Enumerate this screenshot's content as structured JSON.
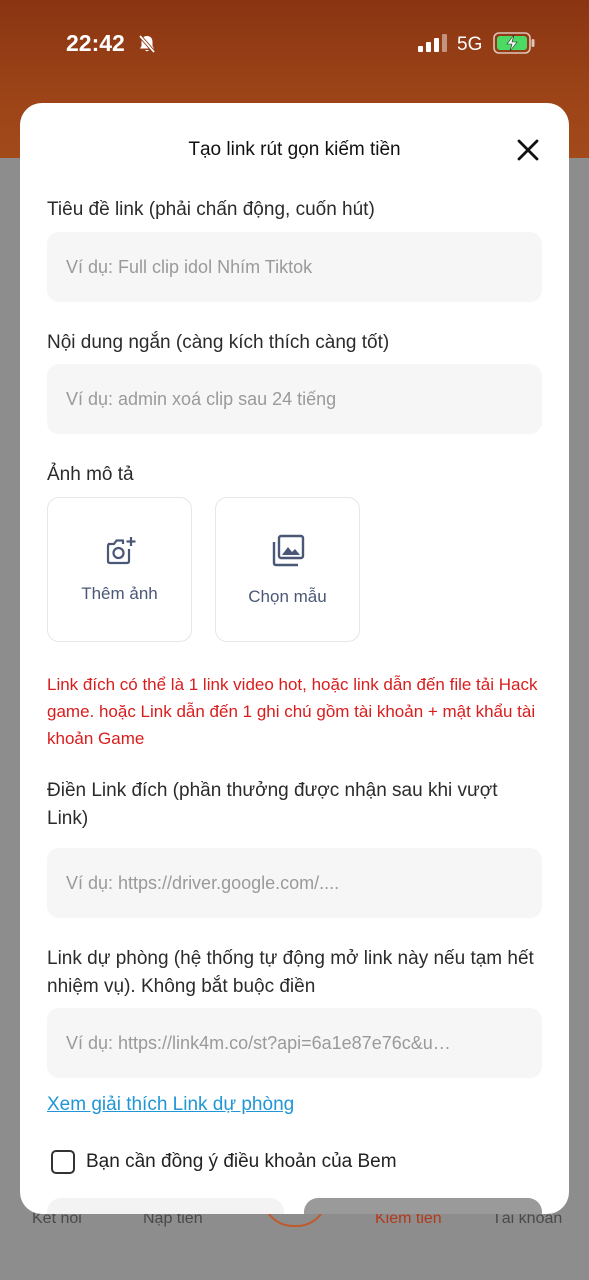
{
  "status_bar": {
    "time": "22:42",
    "network": "5G",
    "icons": [
      "bell-muted-icon",
      "signal-icon",
      "battery-charging-icon"
    ]
  },
  "bottom_nav": {
    "items": [
      "Kết nối",
      "Nạp tiền",
      "Kiếm tiền",
      "Tài khoản"
    ],
    "active": "Kiếm tiền"
  },
  "modal": {
    "title": "Tạo link rút gọn kiếm tiền",
    "title_field": {
      "label": "Tiêu đề link (phải chấn động, cuốn hút)",
      "placeholder": "Ví dụ: Full clip idol Nhím Tiktok"
    },
    "content_field": {
      "label": "Nội dung ngắn (càng kích thích càng tốt)",
      "placeholder": "Ví dụ: admin xoá clip sau 24 tiếng"
    },
    "image_section": {
      "label": "Ảnh mô tả",
      "add_photo": "Thêm ảnh",
      "choose_template": "Chọn mẫu"
    },
    "warning": "Link đích có thể là 1 link video hot, hoặc link dẫn đến file tải Hack game. hoặc Link dẫn đến 1 ghi chú gồm tài khoản + mật khẩu tài khoản Game",
    "target_field": {
      "label": "Điền Link đích (phần thưởng được nhận sau khi vượt Link)",
      "placeholder": "Ví dụ: https://driver.google.com/...."
    },
    "backup_field": {
      "label": "Link dự phòng (hệ thống tự động mở link này nếu tạm hết nhiệm vụ). Không bắt buộc điền",
      "placeholder": "Ví dụ: https://link4m.co/st?api=6a1e87e76c&u…"
    },
    "help_link": "Xem giải thích Link dự phòng",
    "agree_label": "Bạn cần đồng ý điều khoản của Bem",
    "agree_checked": false
  },
  "colors": {
    "accent_red": "#d91d1d",
    "link_blue": "#2196d6",
    "header_brown": "#8a3412"
  }
}
